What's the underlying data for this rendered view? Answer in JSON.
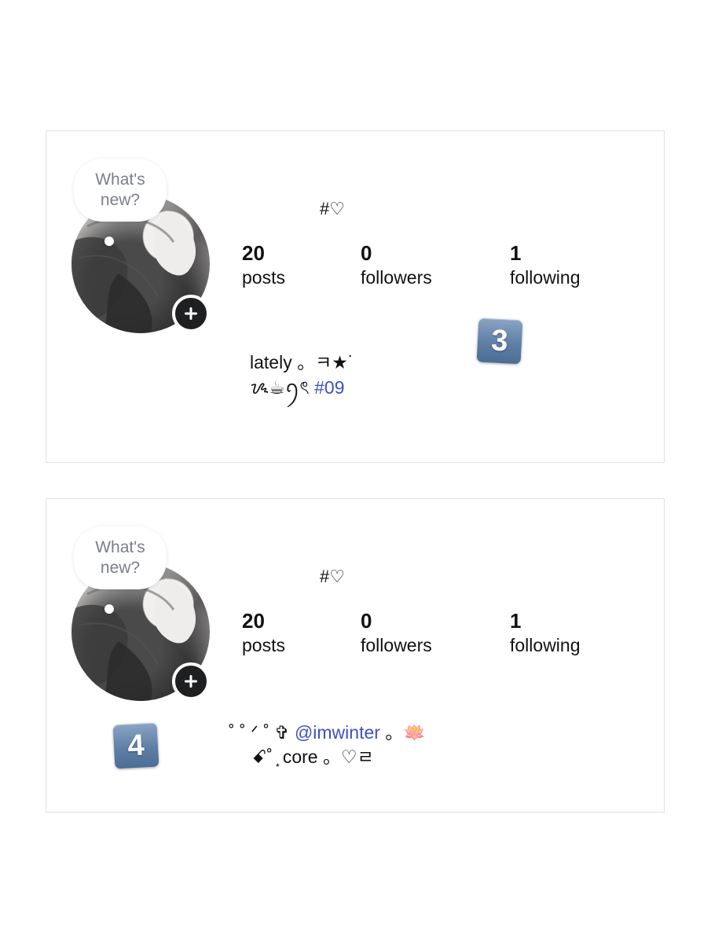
{
  "profiles": [
    {
      "bubble_text": "What's new?",
      "handle": "#♡",
      "stats": [
        {
          "value": "20",
          "label": "posts"
        },
        {
          "value": "0",
          "label": "followers"
        },
        {
          "value": "1",
          "label": "following"
        }
      ],
      "bio_line1": "lately 。ㅋ★˙",
      "bio_line2_prefix": "ᝰ☕ꪆৎ ",
      "bio_line2_link": "#09",
      "badge": "3"
    },
    {
      "bubble_text": "What's new?",
      "handle": "#♡",
      "stats": [
        {
          "value": "20",
          "label": "posts"
        },
        {
          "value": "0",
          "label": "followers"
        },
        {
          "value": "1",
          "label": "following"
        }
      ],
      "bio_line1_prefix": "˚ ˚ ᐟ ˚ ✞ ",
      "bio_line1_link": "@imwinter",
      "bio_line1_suffix": " 。🪷",
      "bio_line2": "ꗃ˚ ͙ core 。♡ㄹ",
      "badge": "4"
    }
  ],
  "icons": {
    "plus": "plus-icon",
    "avatar": "avatar-photo"
  },
  "colors": {
    "link": "#3f4fc4",
    "badge": "#5f7fa6",
    "plus_button": "#1e1f21"
  }
}
